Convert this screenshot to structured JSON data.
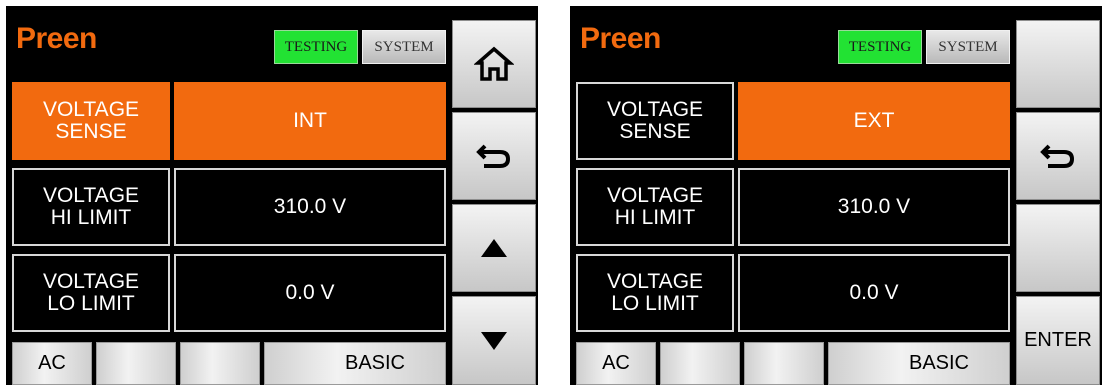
{
  "colors": {
    "accent": "#f26a0f",
    "testing_tab": "#22e233",
    "screen_bg": "#000000"
  },
  "left": {
    "logo": "Preen",
    "tabs": {
      "testing": "TESTING",
      "system": "SYSTEM"
    },
    "rows": [
      {
        "label": "VOLTAGE\nSENSE",
        "value": "INT",
        "active": true
      },
      {
        "label": "VOLTAGE\nHI LIMIT",
        "value": "310.0 V",
        "active": false
      },
      {
        "label": "VOLTAGE\nLO LIMIT",
        "value": "0.0 V",
        "active": false
      }
    ],
    "bottom": {
      "ac": "AC",
      "b2": "",
      "b3": "",
      "basic": "BASIC"
    },
    "side": {
      "s1_icon": "home-icon",
      "s2_icon": "return-icon",
      "s3_icon": "arrow-up-icon",
      "s4_icon": "arrow-down-icon"
    }
  },
  "right": {
    "logo": "Preen",
    "tabs": {
      "testing": "TESTING",
      "system": "SYSTEM"
    },
    "rows": [
      {
        "label": "VOLTAGE\nSENSE",
        "value": "EXT",
        "active_value_only": true
      },
      {
        "label": "VOLTAGE\nHI LIMIT",
        "value": "310.0 V"
      },
      {
        "label": "VOLTAGE\nLO LIMIT",
        "value": "0.0 V"
      }
    ],
    "bottom": {
      "ac": "AC",
      "b2": "",
      "b3": "",
      "basic": "BASIC"
    },
    "side": {
      "s2_icon": "return-icon",
      "enter": "ENTER"
    }
  }
}
